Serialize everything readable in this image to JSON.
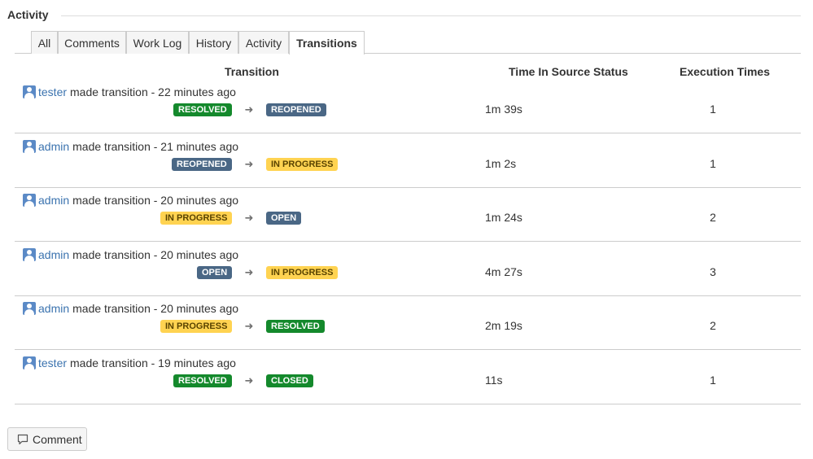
{
  "section": {
    "title": "Activity"
  },
  "tabs": [
    {
      "label": "All"
    },
    {
      "label": "Comments"
    },
    {
      "label": "Work Log"
    },
    {
      "label": "History"
    },
    {
      "label": "Activity"
    },
    {
      "label": "Transitions"
    }
  ],
  "active_tab": "Transitions",
  "table": {
    "headers": {
      "transition": "Transition",
      "time": "Time In Source Status",
      "count": "Execution Times"
    },
    "rows": [
      {
        "user": "tester",
        "action": "made transition - 22 minutes ago",
        "from": "RESOLVED",
        "to": "REOPENED",
        "time": "1m 39s",
        "count": "1"
      },
      {
        "user": "admin",
        "action": "made transition - 21 minutes ago",
        "from": "REOPENED",
        "to": "IN PROGRESS",
        "time": "1m 2s",
        "count": "1"
      },
      {
        "user": "admin",
        "action": "made transition - 20 minutes ago",
        "from": "IN PROGRESS",
        "to": "OPEN",
        "time": "1m 24s",
        "count": "2"
      },
      {
        "user": "admin",
        "action": "made transition - 20 minutes ago",
        "from": "OPEN",
        "to": "IN PROGRESS",
        "time": "4m 27s",
        "count": "3"
      },
      {
        "user": "admin",
        "action": "made transition - 20 minutes ago",
        "from": "IN PROGRESS",
        "to": "RESOLVED",
        "time": "2m 19s",
        "count": "2"
      },
      {
        "user": "tester",
        "action": "made transition - 19 minutes ago",
        "from": "RESOLVED",
        "to": "CLOSED",
        "time": "11s",
        "count": "1"
      }
    ]
  },
  "status_colors": {
    "RESOLVED": "#14892c",
    "CLOSED": "#14892c",
    "REOPENED": "#4a6785",
    "OPEN": "#4a6785",
    "IN PROGRESS": "#ffd351"
  },
  "icons": {
    "avatar": "user-avatar-icon",
    "arrow": "arrow-right-icon",
    "comment": "comment-icon"
  },
  "comment_button": {
    "label": "Comment"
  }
}
